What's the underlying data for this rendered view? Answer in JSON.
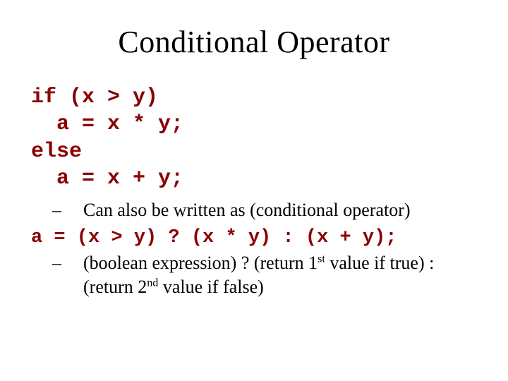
{
  "title": "Conditional Operator",
  "code": {
    "l1": "if (x > y)",
    "l2": "  a = x * y;",
    "l3": "else",
    "l4": "  a = x + y;"
  },
  "bullets": {
    "a": "Can also be written as (conditional operator)",
    "b_pre": "(boolean expression) ? (return 1",
    "b_sup1": "st",
    "b_mid": " value if true) : (return 2",
    "b_sup2": "nd",
    "b_post": " value if false)"
  },
  "ternary": "a = (x > y) ? (x * y) : (x + y);"
}
